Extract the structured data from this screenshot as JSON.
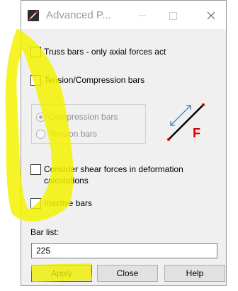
{
  "window": {
    "title": "Advanced P...",
    "icon": "bar-properties-icon"
  },
  "options": {
    "truss_bars": {
      "label": "Truss bars - only axial forces act",
      "checked": false
    },
    "tension_compression": {
      "label": "Tension/Compression bars",
      "checked": false
    },
    "shear_forces": {
      "label": "Consider shear forces in deformation calculations",
      "checked": false
    },
    "inactive_bars": {
      "label": "Inactive bars",
      "checked": false
    }
  },
  "bar_type_group": {
    "compression_label": "Compression bars",
    "tension_label": "Tension bars",
    "selected": "compression",
    "enabled": false
  },
  "diagram": {
    "force_label": "F",
    "bar_color": "#000000",
    "arrow_color": "#2e86c1",
    "force_color": "#e00000"
  },
  "bar_list": {
    "label": "Bar list:",
    "value": "225"
  },
  "buttons": {
    "apply": "Apply",
    "close": "Close",
    "help": "Help"
  },
  "colors": {
    "highlighter": "#f2f200",
    "dialog_bg": "#f0f0f0"
  }
}
